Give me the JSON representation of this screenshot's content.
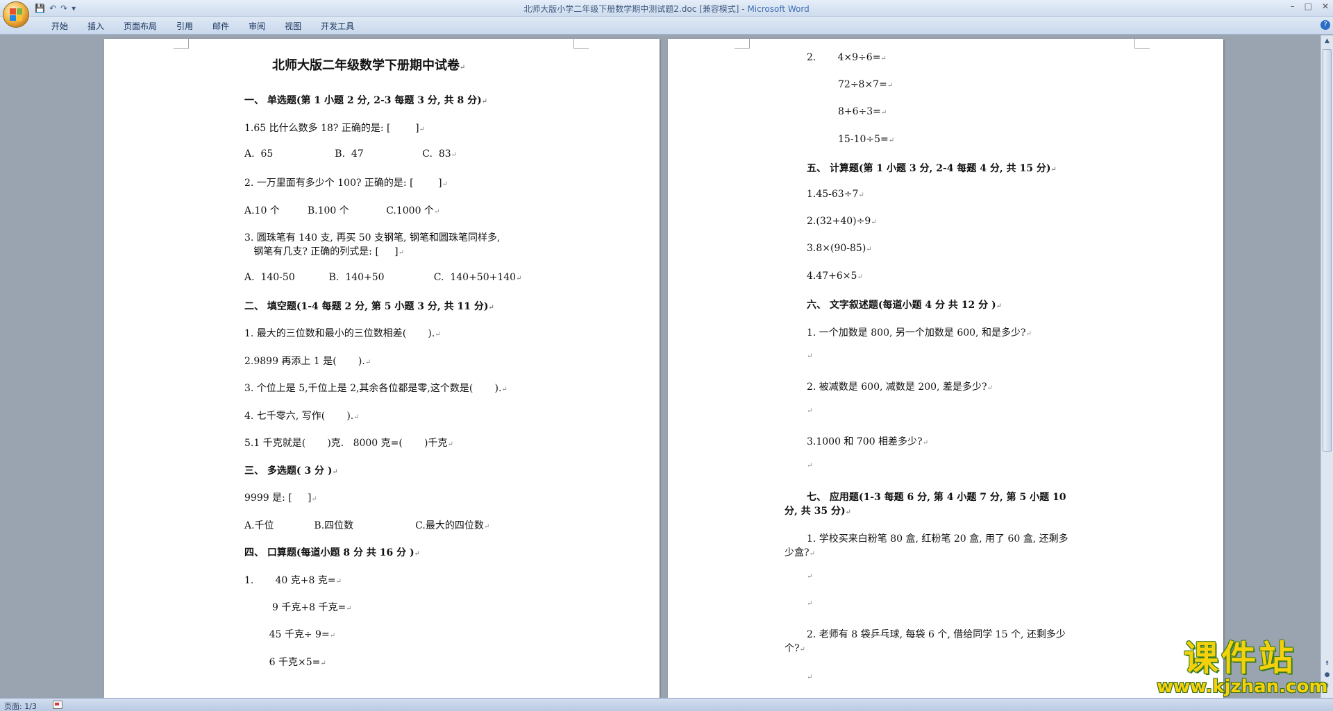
{
  "window": {
    "title": "北师大版小学二年级下册数学期中测试题2.doc [兼容模式]",
    "separator": " - ",
    "app_name": "Microsoft Word",
    "controls": [
      "–",
      "□",
      "✕"
    ]
  },
  "quick_access": {
    "save": "💾",
    "undo": "↶",
    "redo": "↷",
    "more": "▾"
  },
  "ribbon": {
    "tabs": [
      "开始",
      "插入",
      "页面布局",
      "引用",
      "邮件",
      "审阅",
      "视图",
      "开发工具"
    ],
    "help": "?"
  },
  "page1": {
    "title": "北师大版二年级数学下册期中试卷",
    "lines": [
      "一、 单选题(第 1 小题 2 分, 2-3 每题 3 分, 共 8 分)",
      "1.65 比什么数多 18? 正确的是: [        ]",
      "A.  65                    B.  47                   C.  83",
      "2. 一万里面有多少个 100? 正确的是: [        ]",
      "A.10 个         B.100 个            C.1000 个",
      "3. 圆珠笔有 140 支, 再买 50 支钢笔, 钢笔和圆珠笔同样多,",
      "   钢笔有几支? 正确的列式是: [     ]",
      "A.  140-50           B.  140+50                C.  140+50+140",
      "二、 填空题(1-4 每题 2 分, 第 5 小题 3 分, 共 11 分)",
      "1. 最大的三位数和最小的三位数相差(       ).",
      "2.9899 再添上 1 是(       ).",
      "3. 个位上是 5,千位上是 2,其余各位都是零,这个数是(       ).",
      "4. 七千零六, 写作(       ).",
      "5.1 千克就是(       )克.   8000 克=(       )千克",
      "三、 多选题( 3 分 )",
      "9999 是: [     ]",
      "A.千位             B.四位数                    C.最大的四位数",
      "四、 口算题(每道小题 8 分 共 16 分 )",
      "1.       40 克+8 克=",
      "         9 千克+8 千克=",
      "        45 千克÷ 9=",
      "        6 千克×5="
    ]
  },
  "page2": {
    "lines": [
      "2.       4×9÷6=",
      "72÷8×7=",
      "8+6÷3=",
      "15-10÷5=",
      "五、 计算题(第 1 小题 3 分, 2-4 每题 4 分, 共 15 分)",
      "1.45-63÷7",
      "2.(32+40)÷9",
      "3.8×(90-85)",
      "4.47+6×5",
      "六、 文字叙述题(每道小题 4 分 共 12 分 )",
      "1. 一个加数是 800, 另一个加数是 600, 和是多少?",
      "2. 被减数是 600, 减数是 200, 差是多少?",
      "3.1000 和 700 相差多少?",
      "七、 应用题(1-3 每题 6 分, 第 4 小题 7 分, 第 5 小题 10",
      "分, 共 35 分)",
      "1. 学校买来白粉笔 80 盒, 红粉笔 20 盒, 用了 60 盒, 还剩多",
      "少盒?",
      "2. 老师有 8 袋乒乓球, 每袋 6 个, 借给同学 15 个, 还剩多少",
      "个?"
    ],
    "para_mark": "↵"
  },
  "status": {
    "page": "页面: 1/3"
  },
  "watermark": {
    "big": "课件站",
    "small": "www.kjzhan.com"
  }
}
